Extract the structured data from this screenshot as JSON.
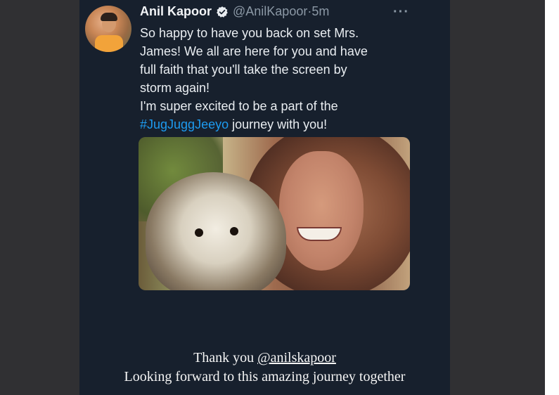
{
  "tweet": {
    "display_name": "Anil Kapoor",
    "handle": "@AnilKapoor",
    "separator": "·",
    "time": "5m",
    "more_glyph": "···",
    "lines": [
      "So happy to have you back on set Mrs.",
      "James! We all are here for you and have",
      "full faith that you'll take the screen by",
      "storm again!",
      "I'm super excited to be a part of the"
    ],
    "hashtag": "#JugJuggJeeyo",
    "last_line_rest": " journey with you!",
    "verified_icon": "verified-badge-icon",
    "avatar_icon": "profile-avatar"
  },
  "caption": {
    "thanks": "Thank you ",
    "mention": "@anilskapoor",
    "line2": "Looking forward to this amazing journey together"
  },
  "colors": {
    "story_bg": "#17202d",
    "side_bg": "#303033",
    "hashtag": "#1d9bf0",
    "handle": "#8b98a5"
  }
}
